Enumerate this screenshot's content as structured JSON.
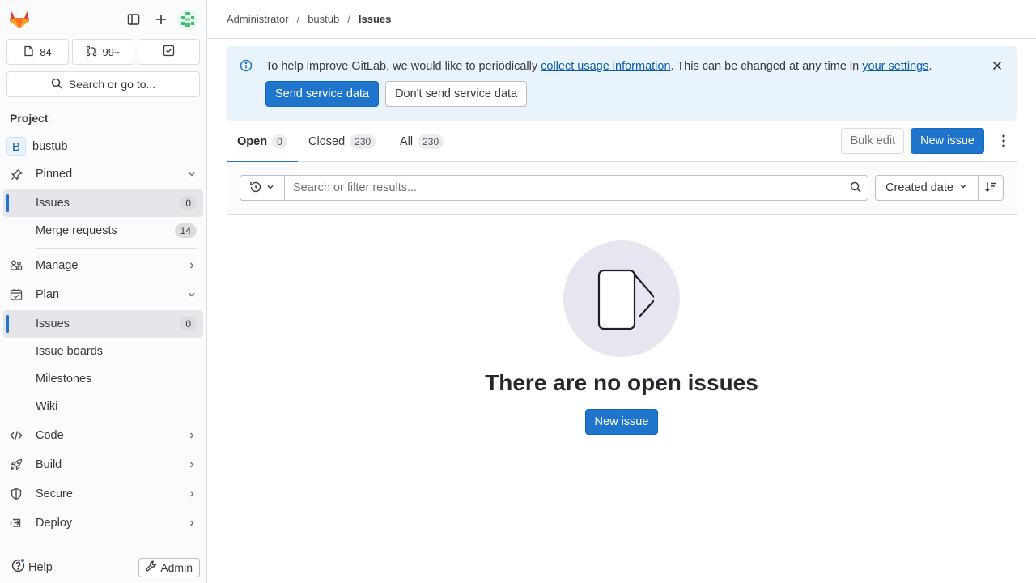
{
  "sidebar": {
    "counters": [
      {
        "icon": "issues-icon",
        "value": "84"
      },
      {
        "icon": "merge-request-icon",
        "value": "99+"
      },
      {
        "icon": "todo-icon",
        "value": ""
      }
    ],
    "search_label": "Search or go to...",
    "section_title": "Project",
    "project_name": "bustub",
    "project_initial": "B",
    "pinned_label": "Pinned",
    "pinned_items": [
      {
        "label": "Issues",
        "count": "0"
      },
      {
        "label": "Merge requests",
        "count": "14"
      }
    ],
    "manage_label": "Manage",
    "plan_label": "Plan",
    "plan_items": [
      {
        "label": "Issues",
        "count": "0"
      },
      {
        "label": "Issue boards"
      },
      {
        "label": "Milestones"
      },
      {
        "label": "Wiki"
      }
    ],
    "code_label": "Code",
    "build_label": "Build",
    "secure_label": "Secure",
    "deploy_label": "Deploy",
    "help_label": "Help",
    "admin_label": "Admin"
  },
  "breadcrumb": {
    "items": [
      "Administrator",
      "bustub",
      "Issues"
    ],
    "separator": "/"
  },
  "banner": {
    "text_before": "To help improve GitLab, we would like to periodically ",
    "link1": "collect usage information",
    "text_middle": ". This can be changed at any time in ",
    "link2": "your settings",
    "text_after": ".",
    "send_label": "Send service data",
    "dont_send_label": "Don't send service data"
  },
  "tabs": [
    {
      "label": "Open",
      "count": "0"
    },
    {
      "label": "Closed",
      "count": "230"
    },
    {
      "label": "All",
      "count": "230"
    }
  ],
  "actions": {
    "bulk_edit": "Bulk edit",
    "new_issue": "New issue"
  },
  "filter": {
    "placeholder": "Search or filter results...",
    "sort_label": "Created date"
  },
  "empty_state": {
    "title": "There are no open issues",
    "button": "New issue"
  },
  "colors": {
    "primary": "#1f75cb",
    "banner_bg": "#e9f3fc",
    "illustration_bg": "#e8e5f1"
  }
}
